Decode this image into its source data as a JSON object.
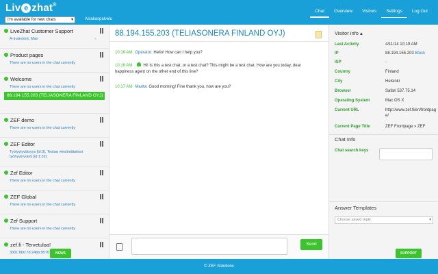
{
  "brand": {
    "logo_text_a": "Liv",
    "logo_text_e": "e",
    "logo_text_b": "zhat",
    "logo_mark": "®"
  },
  "header": {
    "status_select": "I'm available for new chats",
    "department": "Asiakaspalvelu",
    "nav": [
      "Chat",
      "Overview",
      "Visitors",
      "Settings",
      "Log Out"
    ],
    "active_nav": "Chat"
  },
  "sidebar": {
    "groups": [
      {
        "name": "LiveZhat Customer Support",
        "line": "A-Insinöörit, Mari",
        "line_type": "link"
      },
      {
        "name": "Product pages",
        "line": "There are no users in the chat currently",
        "line_type": "empty"
      },
      {
        "name": "Welcome",
        "line": "There are no users in the chat currently",
        "line_type": "empty",
        "active_chat": "88.194.155.203 (TELIASONERA FINLAND OYJ)"
      },
      {
        "name": "ZEF demo",
        "line": "There are no users in the chat currently",
        "line_type": "empty"
      },
      {
        "name": "ZEF Editor",
        "line": "Työtyytyväisyys [id:3], Testaa viestintätaitosi työhyvinvointi [id:1:32]",
        "line_type": "link"
      },
      {
        "name": "Zef Editor",
        "line": "There are no users in the chat currently",
        "line_type": "empty"
      },
      {
        "name": "ZEF Global",
        "line": "There are no users in the chat currently",
        "line_type": "empty"
      },
      {
        "name": "Zef Support",
        "line": "There are no users in the chat currently",
        "line_type": "empty"
      },
      {
        "name": "zef.fi - Tervetuloa!",
        "line": "3001:8b0:7d:24bb:9570:f37b:95ed",
        "line_type": "link"
      }
    ],
    "news_button": "NEWS"
  },
  "chat": {
    "title": "88.194.155.203 (TELIASONERA FINLAND OYJ)",
    "messages": [
      {
        "time": "10:16 AM",
        "author": "Operator:",
        "text": "Hello! How can I help you?"
      },
      {
        "time": "10:16 AM",
        "author": "",
        "text": "Hi! Is this a test chat, or a test chat? This might be a test chat. How are you today, dear happiness agent on the other end of this line?"
      },
      {
        "time": "10:17 AM",
        "author": "Marita:",
        "text": "Good morning! Fine thank you, how are you?"
      }
    ],
    "send_button": "Send",
    "message_placeholder": ""
  },
  "visitor": {
    "heading": "Visitor info ▴",
    "rows": [
      {
        "key": "Last Activity",
        "value": "4/11/14 10:19 AM"
      },
      {
        "key": "IP",
        "value": "88.194.155.203",
        "extra": "Block"
      },
      {
        "key": "ISP",
        "value": "-"
      },
      {
        "key": "Country",
        "value": "Finland"
      },
      {
        "key": "City",
        "value": "Helsinki"
      },
      {
        "key": "Browser",
        "value": "Safari 537.75.14"
      },
      {
        "key": "Operating System",
        "value": "Mac OS X"
      },
      {
        "key": "Current URL",
        "value": "http://www.zef.fi/en/frontpage/"
      },
      {
        "key": "Current Page Title",
        "value": "ZEF Frontpage » ZEF"
      }
    ],
    "chat_info_heading": "Chat Info",
    "chat_search_label": "Chat search keys",
    "answer_templates_heading": "Answer Templates",
    "templates_placeholder": "Choose saved reply",
    "support_button": "SUPPORT"
  },
  "footer": {
    "text": "© ZEF Solutions"
  },
  "colors": {
    "header": "#1aa0d8",
    "accent_green": "#3cc42c",
    "link_blue": "#2a7bc4",
    "label_green": "#2d9c2d"
  }
}
